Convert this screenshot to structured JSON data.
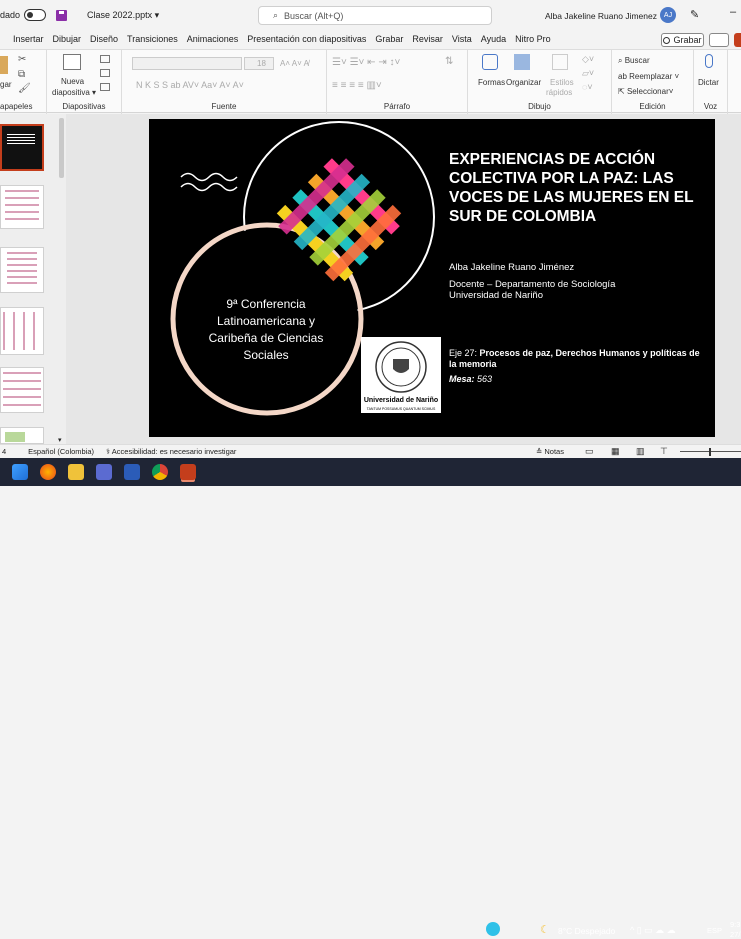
{
  "titlebar": {
    "autosave": "dado",
    "filename": "Clase 2022.pptx",
    "search_placeholder": "Buscar (Alt+Q)",
    "user": "Alba Jakeline Ruano Jimenez",
    "initials": "AJ"
  },
  "tabs": [
    "Insertar",
    "Dibujar",
    "Diseño",
    "Transiciones",
    "Animaciones",
    "Presentación con diapositivas",
    "Grabar",
    "Revisar",
    "Vista",
    "Ayuda",
    "Nitro Pro"
  ],
  "grabar": "Grabar",
  "ribbon": {
    "groups": [
      "apapeles",
      "Diapositivas",
      "Fuente",
      "Párrafo",
      "Dibujo",
      "Edición",
      "Voz"
    ],
    "nueva": "Nueva",
    "diapositiva": "diapositiva",
    "font_size": "18",
    "formas": "Formas",
    "organizar": "Organizar",
    "estilos": "Estilos",
    "rapidos": "rápidos",
    "buscar": "Buscar",
    "reemplazar": "Reemplazar",
    "seleccionar": "Seleccionar",
    "dictar": "Dictar",
    "pegar": "gar"
  },
  "slide": {
    "title": "EXPERIENCIAS DE ACCIÓN COLECTIVA POR LA PAZ: LAS VOCES DE LAS MUJERES EN EL SUR DE COLOMBIA",
    "author": "Alba Jakeline Ruano Jiménez",
    "role": "Docente – Departamento de Sociología",
    "university": "Universidad de Nariño",
    "eje_prefix": "Eje 27: ",
    "eje_bold": "Procesos de paz, Derechos Humanos y políticas de la memoria",
    "mesa_label": "Mesa:",
    "mesa_value": " 563",
    "conference": "9ª Conferencia Latinoamericana y Caribeña de Ciencias Sociales",
    "logo_text": "Universidad de Nariño",
    "logo_motto": "TANTUM POSSUMUS QUANTUM SCIMUS"
  },
  "status": {
    "slide": "4",
    "language": "Español (Colombia)",
    "accessibility": "Accesibilidad: es necesario investigar",
    "notes": "Notas"
  },
  "taskbar": {
    "weather": "8°C  Despejado",
    "lang": "ESP",
    "time": "9:3",
    "date": "27/"
  },
  "colors": {
    "accent": "#c43e1c",
    "slide_bg": "#000000",
    "taskbar": "#1f2535"
  }
}
